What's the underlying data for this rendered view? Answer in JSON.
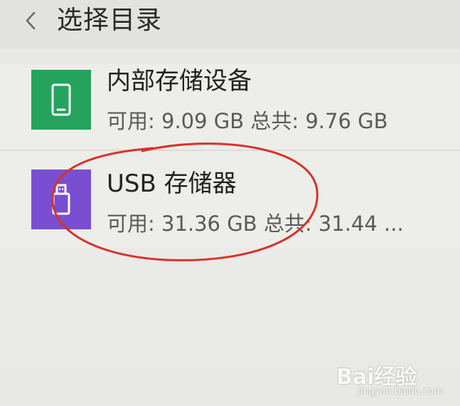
{
  "header": {
    "title": "选择目录",
    "back_icon": "chevron-left-icon"
  },
  "storage_items": [
    {
      "name": "内部存储设备",
      "detail": "可用: 9.09 GB 总共: 9.76 GB",
      "icon": "phone-icon",
      "color": "#25a35c"
    },
    {
      "name": "USB 存储器",
      "detail": "可用: 31.36 GB 总共: 31.44 ...",
      "icon": "usb-drive-icon",
      "color": "#7a4ed0"
    }
  ],
  "annotation": {
    "color": "#d8322a",
    "shape": "ellipse"
  },
  "watermark": {
    "brand": "Bai经验",
    "url": "jingyan.baidu.com"
  }
}
